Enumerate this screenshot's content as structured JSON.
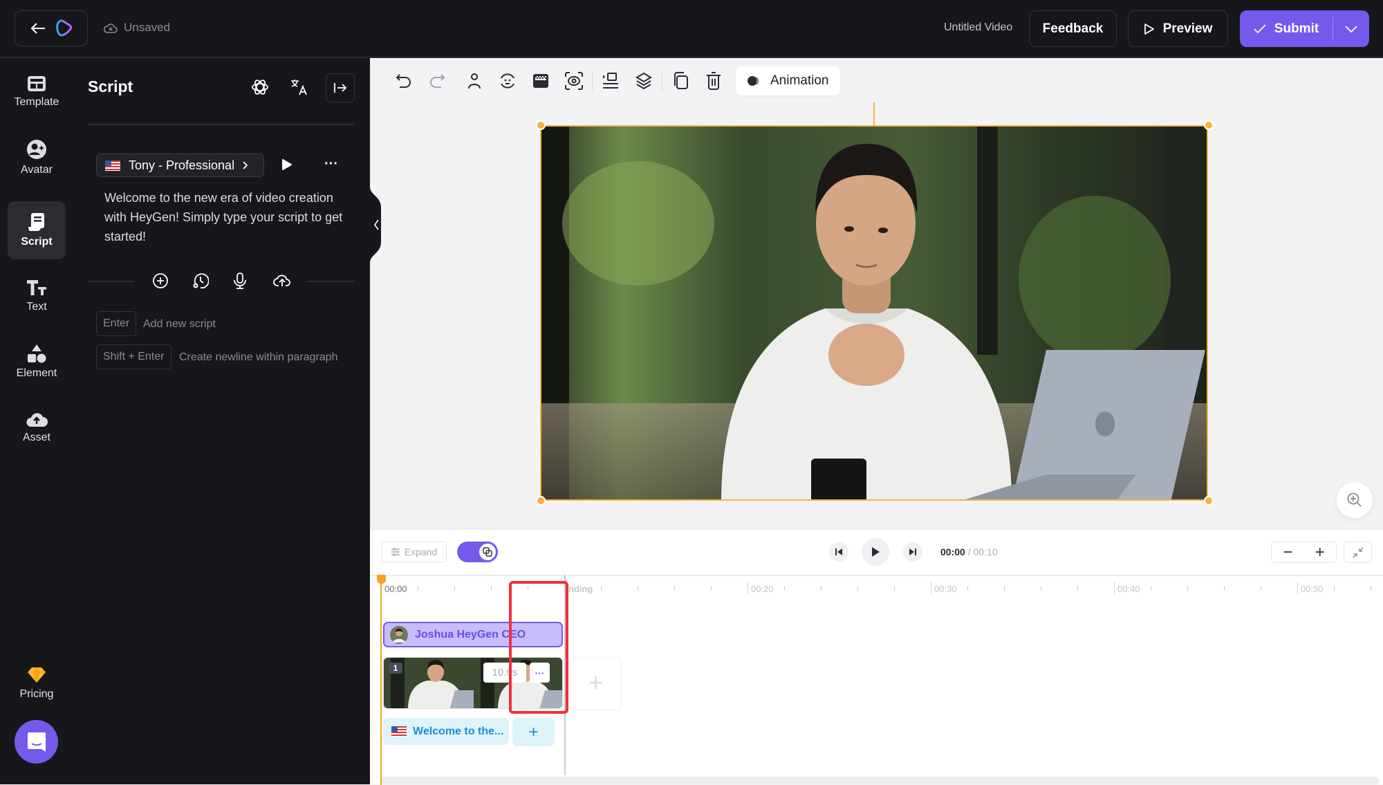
{
  "topbar": {
    "save_status": "Unsaved",
    "video_title": "Untitled Video",
    "feedback_label": "Feedback",
    "preview_label": "Preview",
    "submit_label": "Submit"
  },
  "sidebar": {
    "items": [
      {
        "label": "Template",
        "icon": "template-icon"
      },
      {
        "label": "Avatar",
        "icon": "avatar-icon"
      },
      {
        "label": "Script",
        "icon": "script-icon",
        "active": true
      },
      {
        "label": "Text",
        "icon": "text-icon"
      },
      {
        "label": "Element",
        "icon": "element-icon"
      },
      {
        "label": "Asset",
        "icon": "upload-icon"
      }
    ],
    "pricing_label": "Pricing"
  },
  "script_panel": {
    "title": "Script",
    "voice_name": "Tony - Professional",
    "script_text": "Welcome to the new era of video creation with HeyGen! Simply type your script to get started!",
    "shortcuts": [
      {
        "key": "Enter",
        "desc": "Add new script"
      },
      {
        "key": "Shift + Enter",
        "desc": "Create newline within paragraph"
      }
    ]
  },
  "toolbar": {
    "animation_label": "Animation"
  },
  "timeline": {
    "expand_label": "Expand",
    "current_time": "00:00",
    "total_time": "/ 00:10",
    "ruler_labels": [
      "00:00",
      "nding",
      "00:20",
      "00:30",
      "00:40",
      "00:50"
    ],
    "avatar_clip_label": "Joshua HeyGen CEO",
    "scene_number": "1",
    "scene_duration": "10.0s",
    "scene_more": "···",
    "text_clip_label": "Welcome to the...",
    "add_symbol": "+"
  },
  "colors": {
    "accent": "#7559ea",
    "selection": "#f5b33b",
    "playhead": "#f7a21b",
    "highlight": "#f0303a"
  }
}
